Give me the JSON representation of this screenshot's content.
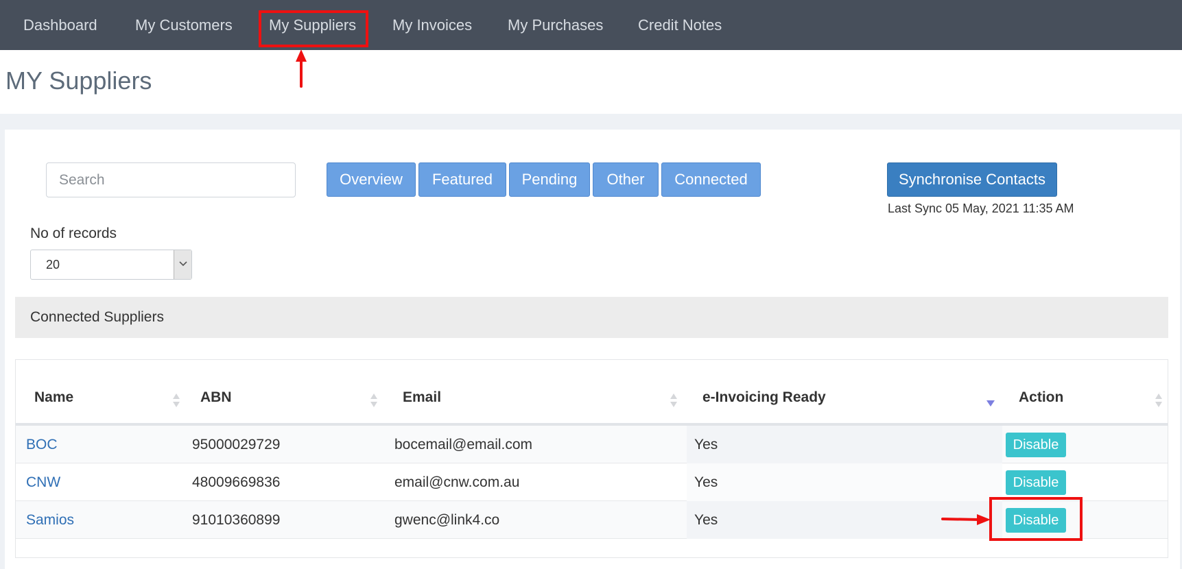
{
  "nav": {
    "items": [
      {
        "label": "Dashboard"
      },
      {
        "label": "My Customers"
      },
      {
        "label": "My Suppliers"
      },
      {
        "label": "My Invoices"
      },
      {
        "label": "My Purchases"
      },
      {
        "label": "Credit Notes"
      }
    ]
  },
  "page": {
    "title": "MY Suppliers"
  },
  "filters": {
    "search_placeholder": "Search",
    "buttons": [
      "Overview",
      "Featured",
      "Pending",
      "Other",
      "Connected"
    ]
  },
  "sync": {
    "button_label": "Synchronise Contacts",
    "last_sync": "Last Sync 05 May, 2021 11:35 AM"
  },
  "records": {
    "label": "No of records",
    "selected": "20"
  },
  "section": {
    "title": "Connected Suppliers"
  },
  "table": {
    "headers": [
      "Name",
      "ABN",
      "Email",
      "e-Invoicing Ready",
      "Action"
    ],
    "rows": [
      {
        "name": "BOC",
        "abn": "95000029729",
        "email": "bocemail@email.com",
        "einvoicing": "Yes",
        "action": "Disable"
      },
      {
        "name": "CNW",
        "abn": "48009669836",
        "email": "email@cnw.com.au",
        "einvoicing": "Yes",
        "action": "Disable"
      },
      {
        "name": "Samios",
        "abn": "91010360899",
        "email": "gwenc@link4.co",
        "einvoicing": "Yes",
        "action": "Disable"
      }
    ]
  },
  "colors": {
    "nav_bg": "#474f5b",
    "filter_button": "#6aa1e3",
    "sync_button": "#3a7fc1",
    "disable_button": "#3bc4cd",
    "link": "#2f6fb5",
    "annotation_red": "#ee1111"
  },
  "icons": [
    "sort-icon",
    "sort-desc-icon",
    "chevron-down-icon",
    "red-arrow-annotation"
  ]
}
